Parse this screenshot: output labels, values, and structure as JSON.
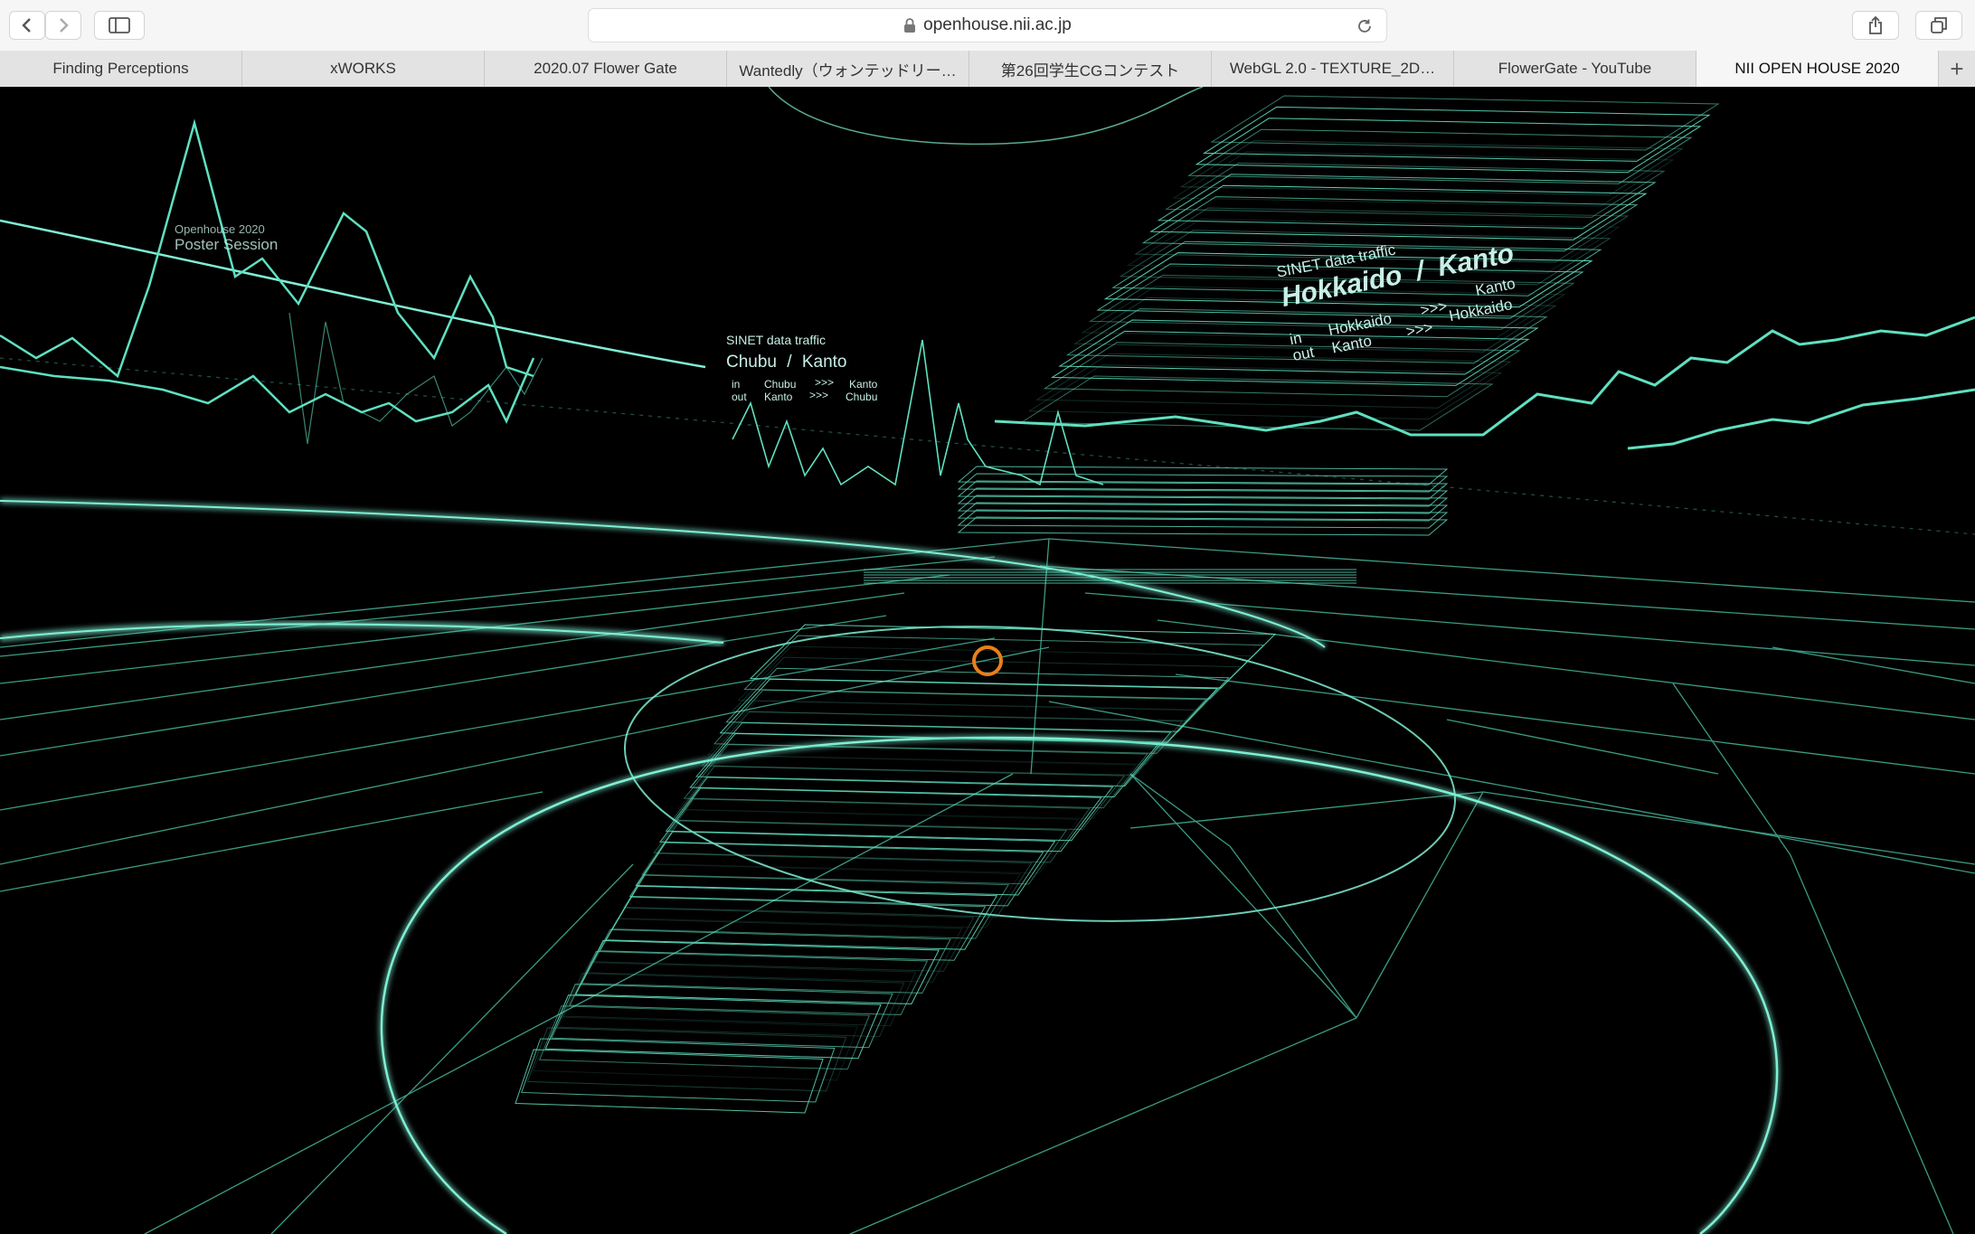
{
  "browser": {
    "url": "openhouse.nii.ac.jp",
    "icons": {
      "back": "chevron-left-icon",
      "forward": "chevron-right-icon",
      "sidebar": "sidebar-icon",
      "lock": "lock-icon",
      "reload": "reload-icon",
      "share": "share-icon",
      "tabs": "tabs-overview-icon",
      "new_tab": "plus-icon"
    }
  },
  "tabs": [
    {
      "label": "Finding Perceptions",
      "active": false
    },
    {
      "label": "xWORKS",
      "active": false
    },
    {
      "label": "2020.07 Flower Gate",
      "active": false
    },
    {
      "label": "Wantedly（ウォンテッドリー…",
      "active": false
    },
    {
      "label": "第26回学生CGコンテスト",
      "active": false
    },
    {
      "label": "WebGL 2.0 - TEXTURE_2D…",
      "active": false
    },
    {
      "label": "FlowerGate - YouTube",
      "active": false
    },
    {
      "label": "NII OPEN HOUSE 2020",
      "active": true
    }
  ],
  "new_tab_label": "+",
  "scene": {
    "colors": {
      "line": "#5fe0c0",
      "bright": "#8ff5dc",
      "accent": "#e8801a",
      "background": "#000000"
    },
    "poster": {
      "line1": "Openhouse 2020",
      "line2": "Poster Session"
    },
    "chubu": {
      "header": "SINET data traffic",
      "title": "Chubu / Kanto",
      "in": "in",
      "out": "out",
      "from_in": "Chubu",
      "from_out": "Kanto",
      "arrow": ">>>",
      "to_in": "Kanto",
      "to_out": "Chubu"
    },
    "hokkaido": {
      "header": "SINET data traffic",
      "title": "Hokkaido / Kanto",
      "in": "in",
      "out": "out",
      "from_in": "Hokkaido",
      "from_out": "Kanto",
      "arrow": ">>>",
      "to_in": "Kanto",
      "to_out": "Hokkaido"
    }
  }
}
